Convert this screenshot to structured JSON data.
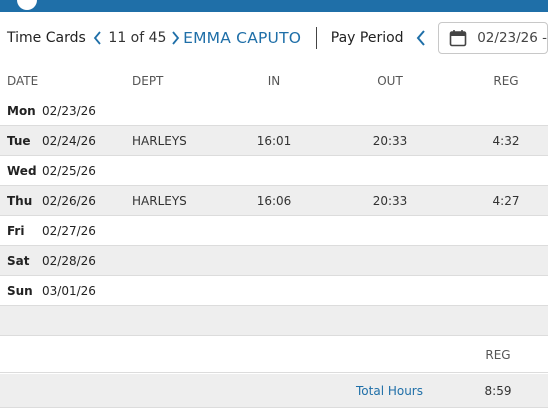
{
  "colors": {
    "accent": "#1f6fa8",
    "row_alt": "#eeeeee",
    "divider": "#dcdcdc"
  },
  "toolbar": {
    "title": "Time Cards",
    "counter": "11 of 45",
    "employee_name": "EMMA CAPUTO",
    "pay_period_label": "Pay Period",
    "date_value": "02/23/26 -",
    "icons": [
      "chevron-left-icon",
      "chevron-right-icon",
      "calendar-icon"
    ]
  },
  "grid": {
    "headers": {
      "date": "DATE",
      "dept": "DEPT",
      "in": "IN",
      "out": "OUT",
      "reg": "REG"
    },
    "rows": [
      {
        "day": "Mon",
        "date": "02/23/26",
        "dept": "",
        "in": "",
        "out": "",
        "reg": ""
      },
      {
        "day": "Tue",
        "date": "02/24/26",
        "dept": "HARLEYS",
        "in": "16:01",
        "out": "20:33",
        "reg": "4:32"
      },
      {
        "day": "Wed",
        "date": "02/25/26",
        "dept": "",
        "in": "",
        "out": "",
        "reg": ""
      },
      {
        "day": "Thu",
        "date": "02/26/26",
        "dept": "HARLEYS",
        "in": "16:06",
        "out": "20:33",
        "reg": "4:27"
      },
      {
        "day": "Fri",
        "date": "02/27/26",
        "dept": "",
        "in": "",
        "out": "",
        "reg": ""
      },
      {
        "day": "Sat",
        "date": "02/28/26",
        "dept": "",
        "in": "",
        "out": "",
        "reg": ""
      },
      {
        "day": "Sun",
        "date": "03/01/26",
        "dept": "",
        "in": "",
        "out": "",
        "reg": ""
      }
    ]
  },
  "summary": {
    "reg_header": "REG",
    "total_label": "Total Hours",
    "total_reg": "8:59"
  }
}
